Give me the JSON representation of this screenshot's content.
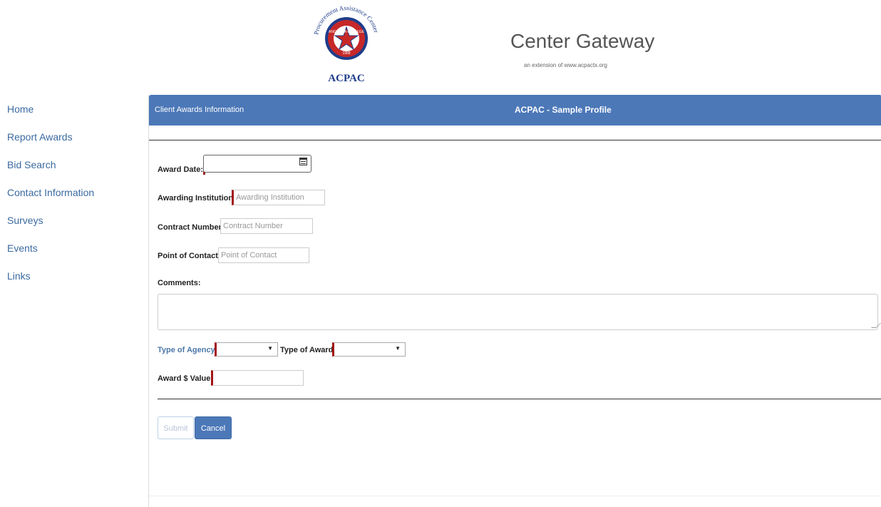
{
  "header": {
    "logo_text": {
      "ring": "Procurement Assistance Center",
      "college": "ANGELINA COLLEGE",
      "year": "1968",
      "acronym": "ACPAC"
    },
    "title": "Center Gateway",
    "subtitle": "an extension of www.acpactx.org"
  },
  "sidebar": {
    "items": [
      {
        "label": "Home"
      },
      {
        "label": "Report Awards"
      },
      {
        "label": "Bid Search"
      },
      {
        "label": "Contact Information"
      },
      {
        "label": "Surveys"
      },
      {
        "label": "Events"
      },
      {
        "label": "Links"
      }
    ]
  },
  "panel": {
    "header_left": "Client Awards Information",
    "header_center": "ACPAC - Sample Profile"
  },
  "form": {
    "award_date": {
      "label": "Award Date:",
      "value": ""
    },
    "awarding_institution": {
      "label": "Awarding Institution:",
      "placeholder": "Awarding Institution"
    },
    "contract_number": {
      "label": "Contract Number:",
      "placeholder": "Contract Number"
    },
    "point_of_contact": {
      "label": "Point of Contact:",
      "placeholder": "Point of Contact"
    },
    "comments": {
      "label": "Comments:",
      "value": ""
    },
    "type_of_agency": {
      "label": "Type of Agency:",
      "selected": ""
    },
    "type_of_award": {
      "label": "Type of Award:",
      "selected": ""
    },
    "award_value": {
      "label": "Award $ Value:",
      "value": ""
    }
  },
  "buttons": {
    "submit": "Submit",
    "cancel": "Cancel"
  },
  "colors": {
    "panel_header": "#4c78b8",
    "required_marker": "#a31515",
    "nav_link": "#3b6aa0"
  },
  "icons": [
    "calendar-icon",
    "dropdown-arrow-icon",
    "resize-grip-icon"
  ]
}
